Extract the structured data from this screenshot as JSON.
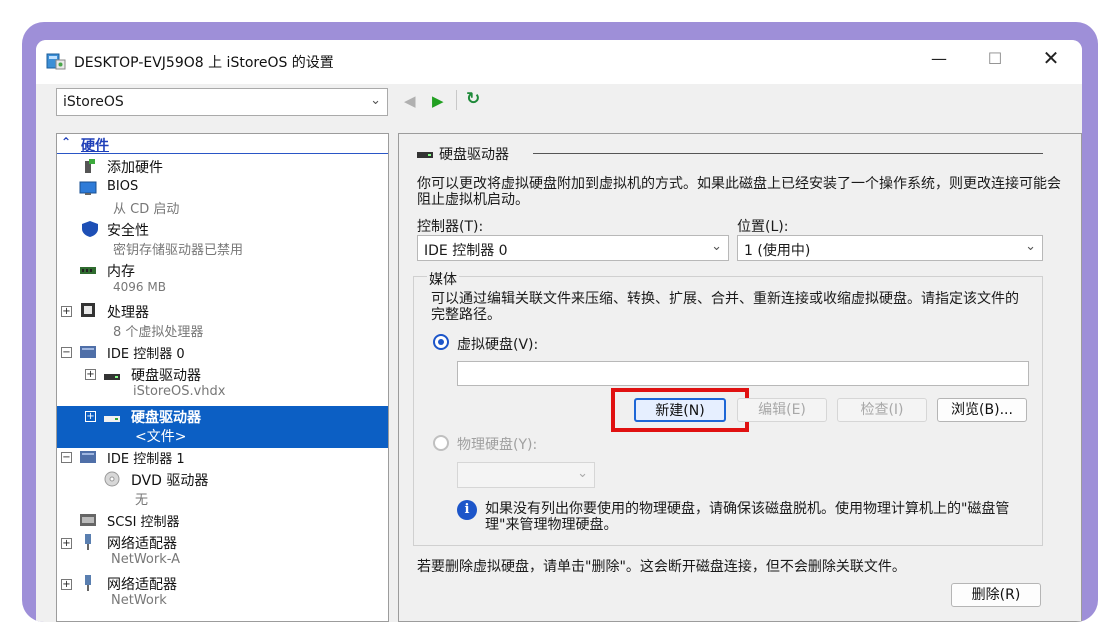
{
  "window": {
    "title": "DESKTOP-EVJ59O8 上 iStoreOS 的设置",
    "minimize_glyph": "—",
    "maximize_glyph": "☐",
    "close_glyph": "✕"
  },
  "vm_selector": {
    "value": "iStoreOS",
    "chevron": "⌄"
  },
  "toolbar": {
    "prev_glyph": "◀",
    "next_glyph": "▶",
    "refresh_glyph": "↻",
    "colors": {
      "prev": "#b0b0b0",
      "next": "#22a022",
      "refresh": "#1f8a3a"
    }
  },
  "tree": {
    "header": {
      "caret": "⌃",
      "label": "硬件"
    },
    "items": [
      {
        "label": "添加硬件"
      },
      {
        "label": "BIOS",
        "sub": "从 CD 启动"
      },
      {
        "label": "安全性",
        "sub": "密钥存储驱动器已禁用"
      },
      {
        "label": "内存",
        "sub": "4096 MB"
      },
      {
        "label": "处理器",
        "sub": "8 个虚拟处理器",
        "expander": "+"
      },
      {
        "label": "IDE 控制器 0",
        "expander": "−"
      },
      {
        "label": "硬盘驱动器",
        "sub": "iStoreOS.vhdx",
        "expander": "+"
      },
      {
        "label": "硬盘驱动器",
        "sub": "<文件>",
        "expander": "+",
        "selected": true
      },
      {
        "label": "IDE 控制器 1",
        "expander": "−"
      },
      {
        "label": "DVD 驱动器",
        "sub": "无"
      },
      {
        "label": "SCSI 控制器"
      },
      {
        "label": "网络适配器",
        "sub": "NetWork-A",
        "expander": "+"
      },
      {
        "label": "网络适配器",
        "sub": "NetWork",
        "expander": "+"
      }
    ]
  },
  "detail": {
    "section_title": "硬盘驱动器",
    "description": "你可以更改将虚拟硬盘附加到虚拟机的方式。如果此磁盘上已经安装了一个操作系统，则更改连接可能会阻止虚拟机启动。",
    "controller_label": "控制器(T):",
    "controller_value": "IDE 控制器 0",
    "location_label": "位置(L):",
    "location_value": "1 (使用中)",
    "media_title": "媒体",
    "media_desc": "可以通过编辑关联文件来压缩、转换、扩展、合并、重新连接或收缩虚拟硬盘。请指定该文件的完整路径。",
    "vhd_radio_label": "虚拟硬盘(V):",
    "vhd_path_value": "",
    "buttons": {
      "new": "新建(N)",
      "edit": "编辑(E)",
      "inspect": "检查(I)",
      "browse": "浏览(B)..."
    },
    "physical_radio_label": "物理硬盘(Y):",
    "info_glyph": "i",
    "info_text": "如果没有列出你要使用的物理硬盘，请确保该磁盘脱机。使用物理计算机上的\"磁盘管理\"来管理物理硬盘。",
    "remove_note": "若要删除虚拟硬盘，请单击\"删除\"。这会断开磁盘连接，但不会删除关联文件。",
    "remove_button": "删除(R)"
  },
  "colors": {
    "frame": "#9e8fd8",
    "selection": "#0c5fc4",
    "highlight": "#e01111",
    "accent": "#1c55c9"
  }
}
